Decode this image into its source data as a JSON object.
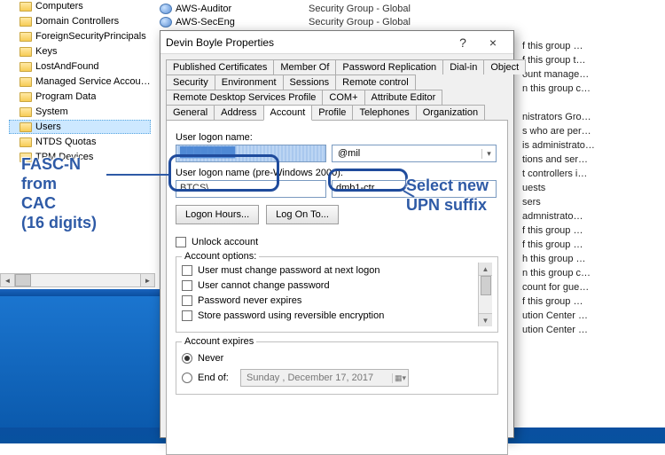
{
  "tree": {
    "items": [
      {
        "label": "Computers"
      },
      {
        "label": "Domain Controllers"
      },
      {
        "label": "ForeignSecurityPrincipals"
      },
      {
        "label": "Keys"
      },
      {
        "label": "LostAndFound"
      },
      {
        "label": "Managed Service Accounts"
      },
      {
        "label": "Program Data"
      },
      {
        "label": "System"
      },
      {
        "label": "Users"
      },
      {
        "label": "NTDS Quotas"
      },
      {
        "label": "TPM Devices"
      }
    ],
    "selected_index": 8
  },
  "groups": [
    {
      "name": "AWS-Auditor",
      "type": "Security Group - Global"
    },
    {
      "name": "AWS-SecEng",
      "type": "Security Group - Global"
    }
  ],
  "right_column": [
    "f this group …",
    "f this group t…",
    "ount manage…",
    "n this group c…",
    "",
    "nistrators Gro…",
    "s who are per…",
    "is administrato…",
    "tions and ser…",
    "t controllers i…",
    "uests",
    "sers",
    "admnistrato…",
    "f this group …",
    "f this group …",
    "h this group …",
    "n this group c…",
    "count for gue…",
    "f this group …",
    "ution Center …",
    "ution Center …"
  ],
  "dialog": {
    "title": "Devin Boyle Properties",
    "help": "?",
    "close": "×",
    "tab_rows": [
      [
        "Published Certificates",
        "Member Of",
        "Password Replication",
        "Dial-in",
        "Object"
      ],
      [
        "Security",
        "Environment",
        "Sessions",
        "Remote control"
      ],
      [
        "Remote Desktop Services Profile",
        "COM+",
        "Attribute Editor"
      ],
      [
        "General",
        "Address",
        "Account",
        "Profile",
        "Telephones",
        "Organization"
      ]
    ],
    "active_tab": "Account",
    "labels": {
      "logon": "User logon name:",
      "pre2000": "User logon name (pre-Windows 2000):",
      "logon_hours": "Logon Hours...",
      "logon_to": "Log On To...",
      "unlock": "Unlock account",
      "options": "Account options:",
      "expires": "Account expires",
      "never": "Never",
      "endof": "End of:"
    },
    "logon_value": "████████",
    "upn_suffix": "@mil",
    "pre2000_domain": "BTCS\\",
    "pre2000_user": "dmb1-ctr",
    "options_list": [
      "User must change password at next logon",
      "User cannot change password",
      "Password never expires",
      "Store password using reversible encryption"
    ],
    "expire_date": "Sunday   , December 17, 2017"
  },
  "annotations": {
    "left": "FASC-N\nfrom\nCAC\n(16 digits)",
    "right": "Select new\nUPN suffix"
  }
}
